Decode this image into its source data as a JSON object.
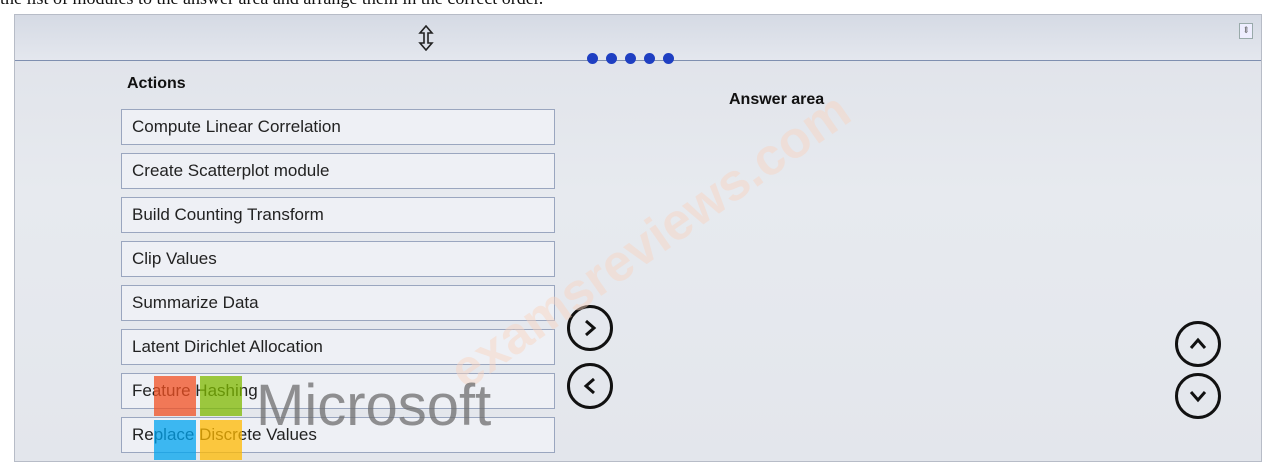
{
  "instruction": "the list of modules to the answer area and arrange them in the correct order.",
  "actions_title": "Actions",
  "answer_title": "Answer area",
  "actions": [
    "Compute Linear Correlation",
    "Create Scatterplot module",
    "Build Counting Transform",
    "Clip Values",
    "Summarize Data",
    "Latent Dirichlet Allocation",
    "Feature Hashing",
    "Replace Discrete Values"
  ],
  "logo_text": "Microsoft",
  "watermark": "examsreviews.com",
  "colors": {
    "dot": "#1f3fc2",
    "logo_red": "#f25022",
    "logo_green": "#7fba00",
    "logo_blue": "#00a4ef",
    "logo_yellow": "#ffb900"
  }
}
